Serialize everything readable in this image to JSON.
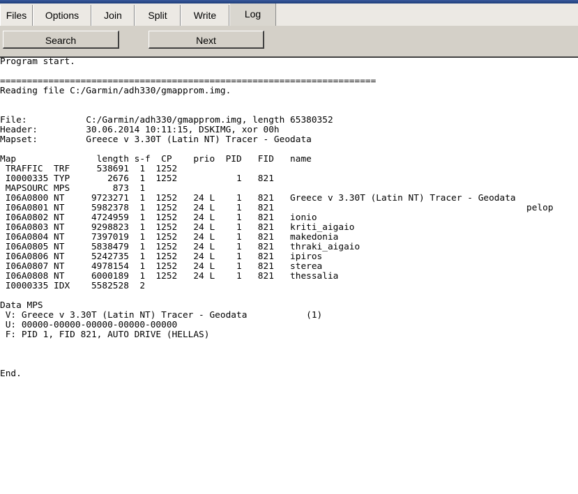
{
  "tabs": [
    {
      "label": "Files"
    },
    {
      "label": "Options"
    },
    {
      "label": "Join"
    },
    {
      "label": "Split"
    },
    {
      "label": "Write"
    },
    {
      "label": "Log",
      "active": true
    }
  ],
  "toolbar": {
    "search_label": "Search",
    "next_label": "Next"
  },
  "log_lines": [
    "Program start.",
    "",
    "======================================================================",
    "Reading file C:/Garmin/adh330/gmapprom.img.",
    "",
    "",
    "File:           C:/Garmin/adh330/gmapprom.img, length 65380352",
    "Header:         30.06.2014 10:11:15, DSKIMG, xor 00h",
    "Mapset:         Greece v 3.30T (Latin NT) Tracer - Geodata",
    "",
    "Map               length s-f  CP    prio  PID   FID   name",
    " TRAFFIC  TRF     538691  1  1252",
    " I0000335 TYP       2676  1  1252           1   821",
    " MAPSOURC MPS        873  1",
    " I06A0800 NT     9723271  1  1252   24 L    1   821   Greece v 3.30T (Latin NT) Tracer - Geodata",
    " I06A0801 NT     5982378  1  1252   24 L    1   821                                               pelop",
    " I06A0802 NT     4724959  1  1252   24 L    1   821   ionio",
    " I06A0803 NT     9298823  1  1252   24 L    1   821   kriti_aigaio",
    " I06A0804 NT     7397019  1  1252   24 L    1   821   makedonia",
    " I06A0805 NT     5838479  1  1252   24 L    1   821   thraki_aigaio",
    " I06A0806 NT     5242735  1  1252   24 L    1   821   ipiros",
    " I06A0807 NT     4978154  1  1252   24 L    1   821   sterea",
    " I06A0808 NT     6000189  1  1252   24 L    1   821   thessalia",
    " I0000335 IDX    5582528  2",
    "",
    "Data MPS",
    " V: Greece v 3.30T (Latin NT) Tracer - Geodata           (1)",
    " U: 00000-00000-00000-00000-00000",
    " F: PID 1, FID 821, AUTO DRIVE (HELLAS)",
    "",
    "",
    "",
    "End."
  ]
}
